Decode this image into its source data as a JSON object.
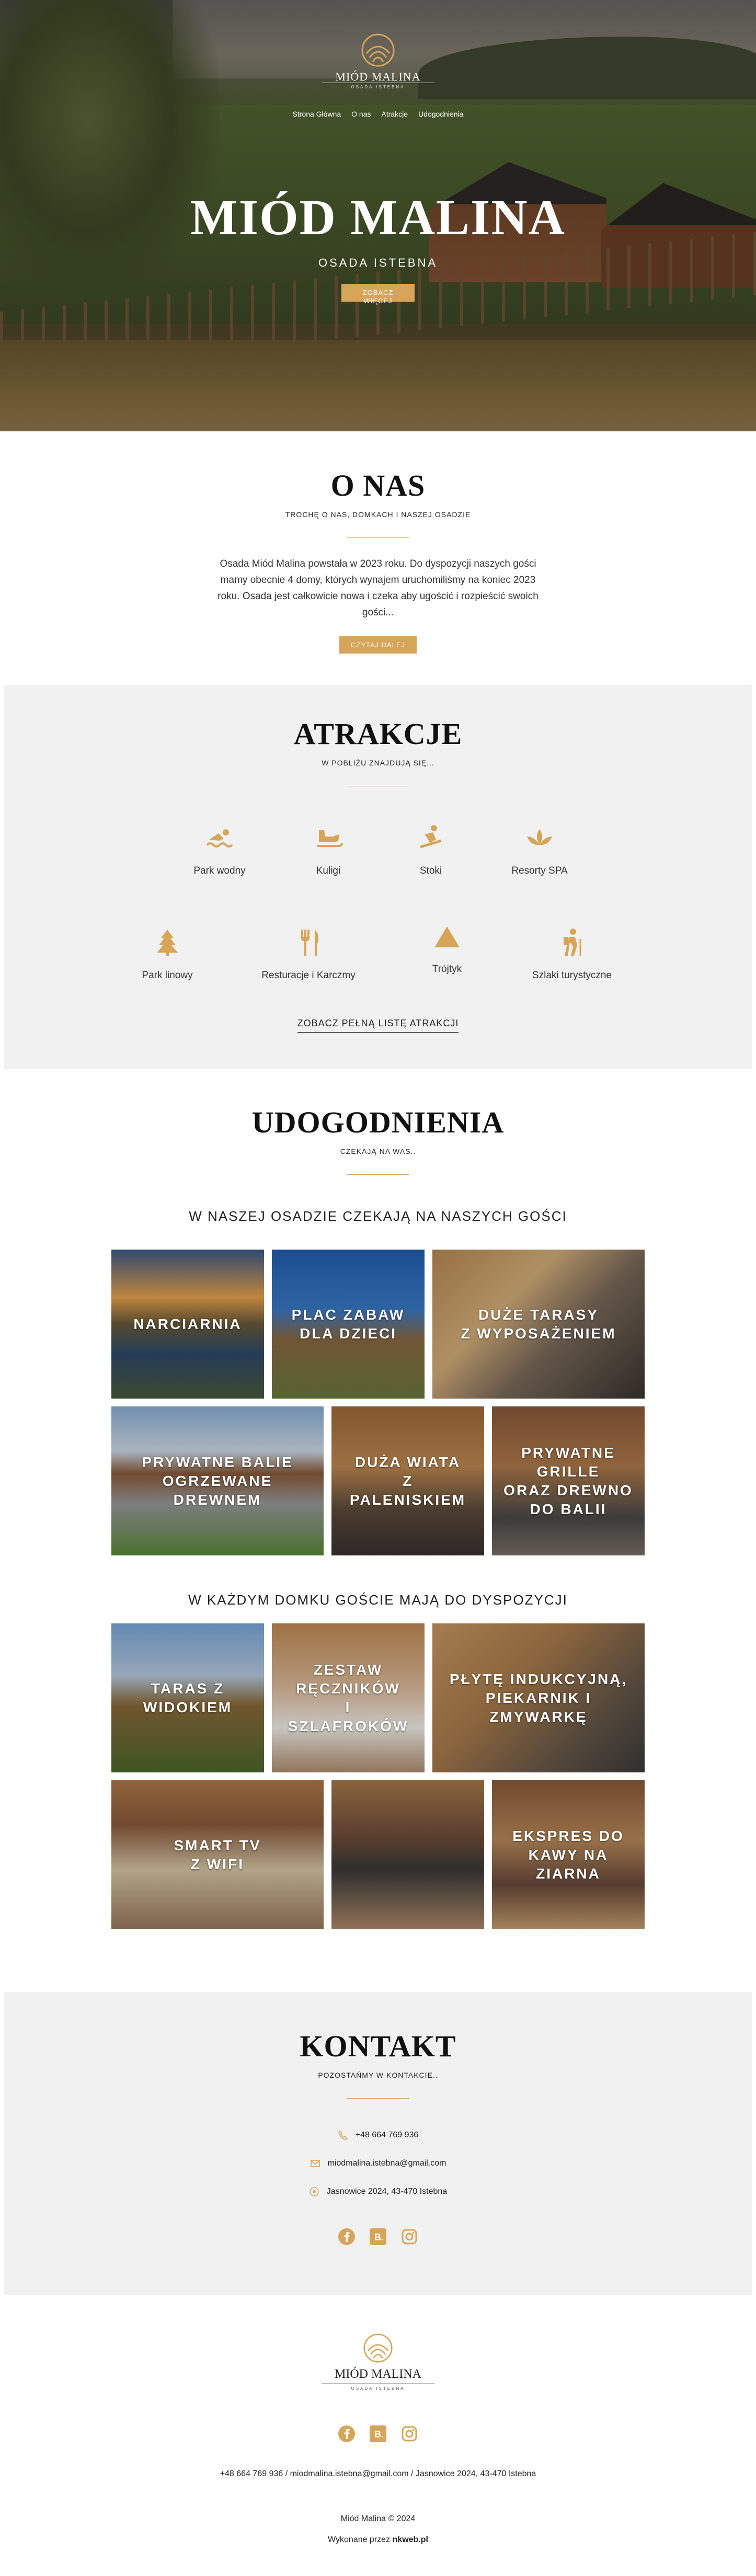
{
  "brand": {
    "name": "MIÓD MALINA",
    "tagline": "OSADA ISTEBNA"
  },
  "colors": {
    "accent": "#d7a55a",
    "dark": "#111111",
    "light_bg": "#f1f1f1"
  },
  "nav": {
    "items": [
      "Strona Główna",
      "O nas",
      "Atrakcje",
      "Udogodnienia"
    ]
  },
  "hero": {
    "title": "MIÓD MALINA",
    "subtitle": "OSADA ISTEBNA",
    "button": "ZOBACZ WIĘCEJ"
  },
  "about": {
    "title": "O NAS",
    "kicker": "TROCHĘ O NAS, DOMKACH I NASZEJ OSADZIE",
    "text": "Osada Miód Malina powstała w 2023 roku. Do dyspozycji naszych gości mamy obecnie 4 domy, których wynajem uruchomiliśmy na koniec 2023 roku. Osada jest całkowicie nowa i czeka aby ugościć i rozpieścić swoich gości...",
    "button": "CZYTAJ DALEJ"
  },
  "attractions": {
    "title": "ATRAKCJE",
    "kicker": "W POBLIŻU ZNAJDUJĄ SIĘ...",
    "items": [
      {
        "label": "Park wodny",
        "icon": "swimmer-icon"
      },
      {
        "label": "Kuligi",
        "icon": "sleigh-icon"
      },
      {
        "label": "Stoki",
        "icon": "snowboarder-icon"
      },
      {
        "label": "Resorty SPA",
        "icon": "spa-lotus-icon"
      },
      {
        "label": "Park linowy",
        "icon": "tree-icon"
      },
      {
        "label": "Resturacje i Karczmy",
        "icon": "utensils-icon"
      },
      {
        "label": "Trójtyk",
        "icon": "triangle-icon"
      },
      {
        "label": "Szlaki turystyczne",
        "icon": "hiker-icon"
      }
    ],
    "link": "ZOBACZ PEŁNĄ LISTĘ ATRAKCJI"
  },
  "amenities": {
    "title": "UDOGODNIENIA",
    "kicker": "CZEKAJĄ NA WAS..",
    "group1_title": "W NASZEJ OSADZIE CZEKAJĄ NA NASZYCH GOŚCI",
    "group1": [
      "NARCIARNIA",
      "PLAC ZABAW\nDLA DZIECI",
      "DUŻE TARASY\nZ WYPOSAŻENIEM",
      "PRYWATNE BALIE\nOGRZEWANE\nDREWNEM",
      "DUŻA WIATA\nZ PALENISKIEM",
      "PRYWATNE\nGRILLE\nORAZ DREWNO\nDO BALII"
    ],
    "group2_title": "W KAŻDYM DOMKU GOŚCIE MAJĄ DO DYSPOZYCJI",
    "group2": [
      "TARAS Z\nWIDOKIEM",
      "ZESTAW\nRĘCZNIKÓW\nI SZLAFROKÓW",
      "PŁYTĘ INDUKCYJNĄ,\nPIEKARNIK I\nZMYWARKĘ",
      "SMART TV\nZ WIFI",
      "",
      "EKSPRES DO\nKAWY NA\nZIARNA"
    ]
  },
  "contact": {
    "title": "KONTAKT",
    "kicker": "POZOSTAŃMY W KONTAKCIE..",
    "phone": "+48 664 769 936",
    "email": "miodmalina.istebna@gmail.com",
    "address": "Jasnowice 2024, 43-470 Istebna"
  },
  "footer": {
    "line": "+48 664 769 936 / miodmalina.istebna@gmail.com / Jasnowice 2024, 43-470 Istebna",
    "copyright": "Miód Malina © 2024",
    "made_by_prefix": "Wykonane przez",
    "made_by": "nkweb.pl"
  },
  "icons": [
    "facebook-icon",
    "booking-icon",
    "instagram-icon",
    "phone-icon",
    "mail-icon",
    "location-icon"
  ]
}
